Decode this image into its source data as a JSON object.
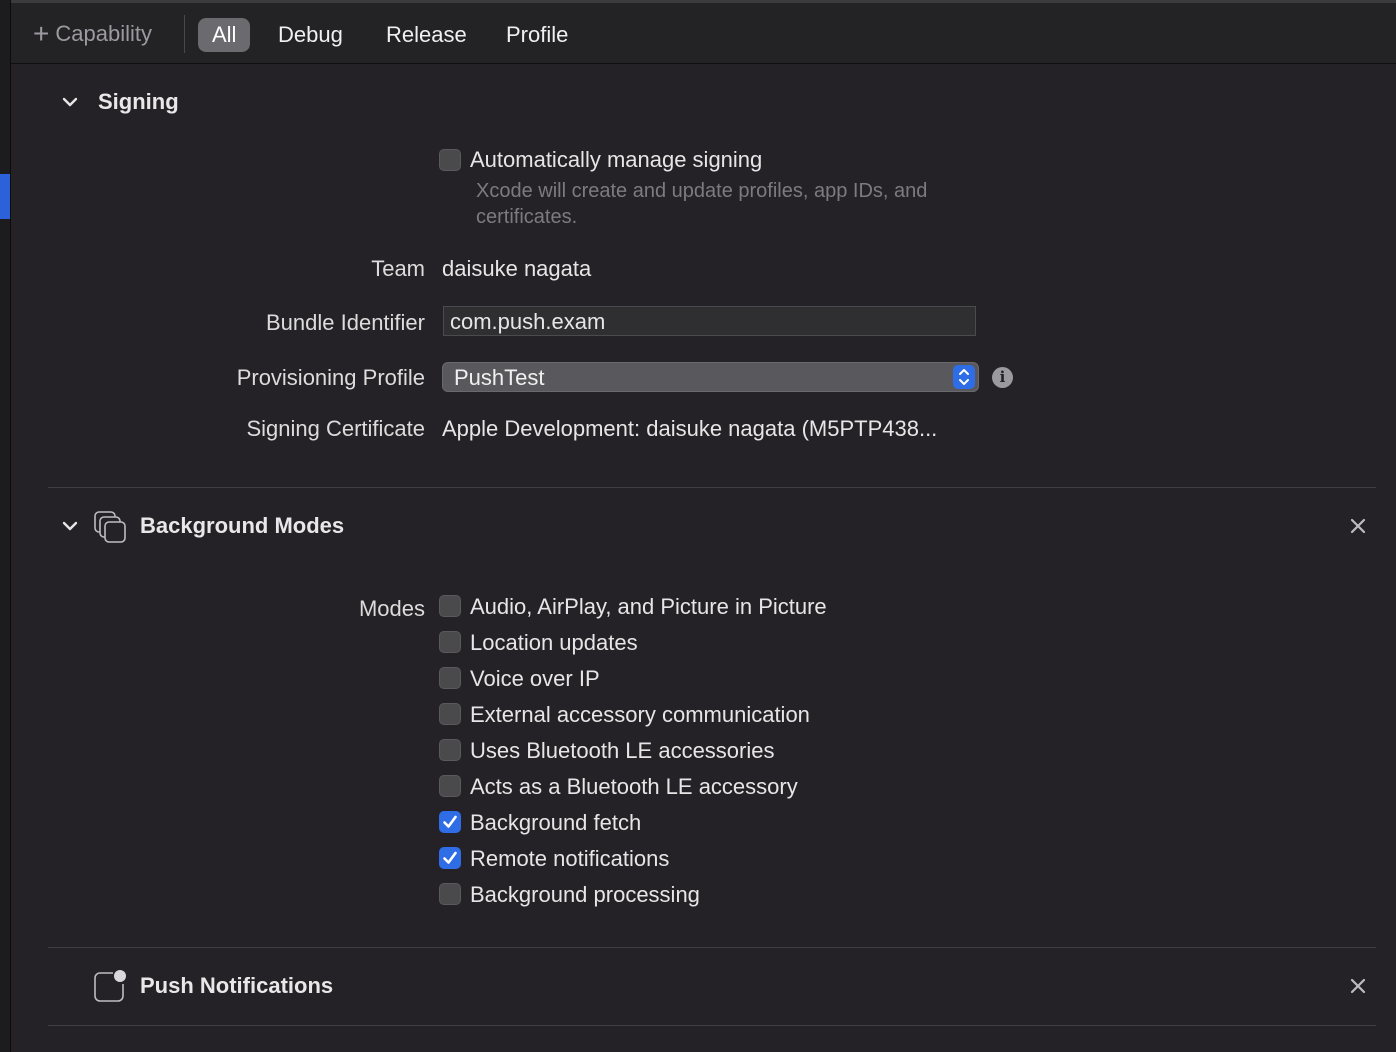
{
  "toolbar": {
    "capability_label": "Capability",
    "tabs": [
      "All",
      "Debug",
      "Release",
      "Profile"
    ],
    "active_tab": "All"
  },
  "signing": {
    "title": "Signing",
    "auto_manage_label": "Automatically manage signing",
    "auto_manage_checked": false,
    "auto_manage_hint": "Xcode will create and update profiles, app IDs, and certificates.",
    "team_label": "Team",
    "team_value": "daisuke nagata",
    "bundle_label": "Bundle Identifier",
    "bundle_value": "com.push.exam",
    "profile_label": "Provisioning Profile",
    "profile_value": "PushTest",
    "cert_label": "Signing Certificate",
    "cert_value": "Apple Development: daisuke nagata (M5PTP438..."
  },
  "background_modes": {
    "title": "Background Modes",
    "modes_label": "Modes",
    "modes": [
      {
        "label": "Audio, AirPlay, and Picture in Picture",
        "checked": false
      },
      {
        "label": "Location updates",
        "checked": false
      },
      {
        "label": "Voice over IP",
        "checked": false
      },
      {
        "label": "External accessory communication",
        "checked": false
      },
      {
        "label": "Uses Bluetooth LE accessories",
        "checked": false
      },
      {
        "label": "Acts as a Bluetooth LE accessory",
        "checked": false
      },
      {
        "label": "Background fetch",
        "checked": true
      },
      {
        "label": "Remote notifications",
        "checked": true
      },
      {
        "label": "Background processing",
        "checked": false
      }
    ]
  },
  "push_notifications": {
    "title": "Push Notifications"
  },
  "colors": {
    "background": "#242226",
    "accent": "#2f6de6",
    "selection_bar": "#2c62d9"
  },
  "icons": {
    "add": "plus-icon",
    "disclosure": "chevron-down-icon",
    "close": "close-icon",
    "info": "info-icon",
    "background_modes": "stacked-windows-icon",
    "push": "notification-badge-icon"
  }
}
